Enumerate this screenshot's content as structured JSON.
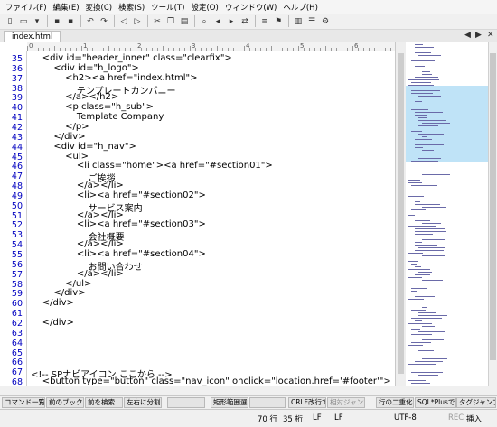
{
  "menu": [
    "ファイル(F)",
    "編集(E)",
    "変換(C)",
    "検索(S)",
    "ツール(T)",
    "設定(O)",
    "ウィンドウ(W)",
    "ヘルプ(H)"
  ],
  "toolbar": {
    "icons": [
      "new-file-icon",
      "open-folder-icon",
      "dropdown-icon",
      "save-icon",
      "save-all-icon",
      "undo-icon",
      "redo-icon",
      "back-icon",
      "forward-icon",
      "cut-icon",
      "copy-icon",
      "paste-icon",
      "find-icon",
      "find-prev-icon",
      "find-next-icon",
      "replace-icon",
      "grep-icon",
      "bookmark-icon",
      "compare-icon",
      "outline-icon",
      "settings-icon"
    ]
  },
  "tab": {
    "label": "index.html",
    "prev": "◀",
    "next": "▶",
    "close": "✕"
  },
  "ruler": {
    "marks": [
      "0",
      "1",
      "2",
      "3",
      "4",
      "5",
      "6",
      "7"
    ]
  },
  "editor": {
    "line_numbers": [
      "35",
      "36",
      "37",
      "38",
      "39",
      "40",
      "41",
      "42",
      "43",
      "44",
      "45",
      "46",
      "47",
      "48",
      "49",
      "50",
      "51",
      "52",
      "53",
      "54",
      "55",
      "56",
      "57",
      "58",
      "59",
      "60",
      "61",
      "62",
      "63",
      "64",
      "65",
      "66",
      "67",
      "68"
    ],
    "lines": [
      "    <div id=\"header_inner\" class=\"clearfix\">",
      "        <div id=\"h_logo\">",
      "            <h2><a href=\"index.html\">",
      "                テンプレートカンパニー",
      "            </a></h2>",
      "            <p class=\"h_sub\">",
      "                Template Company",
      "            </p>",
      "        </div>",
      "        <div id=\"h_nav\">",
      "            <ul>",
      "                <li class=\"home\"><a href=\"#section01\">",
      "                    ご挨拶",
      "                </a></li>",
      "                <li><a href=\"#section02\">",
      "                    サービス案内",
      "                </a></li>",
      "                <li><a href=\"#section03\">",
      "                    会社概要",
      "                </a></li>",
      "                <li><a href=\"#section04\">",
      "                    お問い合わせ",
      "                </a></li>",
      "            </ul>",
      "        </div>",
      "    </div>",
      "",
      "    </div>",
      "",
      "",
      "",
      "",
      "<!-- SPナビアイコン ここから -->",
      "    <button type=\"button\" class=\"nav_icon\" onclick=\"location.href='#footer'\">"
    ]
  },
  "function_bar": [
    {
      "label": "コマンド一覧",
      "disabled": false
    },
    {
      "label": "前のブックマ",
      "disabled": false
    },
    {
      "label": "前を検索",
      "disabled": false
    },
    {
      "label": "左右に分割",
      "disabled": false
    },
    {
      "label": "",
      "disabled": false
    },
    {
      "label": "矩形範囲選",
      "disabled": false
    },
    {
      "label": "",
      "disabled": false
    },
    {
      "label": "CRLF改行で",
      "disabled": false
    },
    {
      "label": "相対ジャンプ",
      "disabled": true
    },
    {
      "label": "行の二重化",
      "disabled": false
    },
    {
      "label": "SQL*Plusで",
      "disabled": false
    },
    {
      "label": "タグジャンプ",
      "disabled": false
    }
  ],
  "status": {
    "line": "70 行",
    "col": "35 桁",
    "newline1": "LF",
    "newline2": "LF",
    "encoding": "UTF-8",
    "rec": "REC",
    "mode": "挿入"
  }
}
